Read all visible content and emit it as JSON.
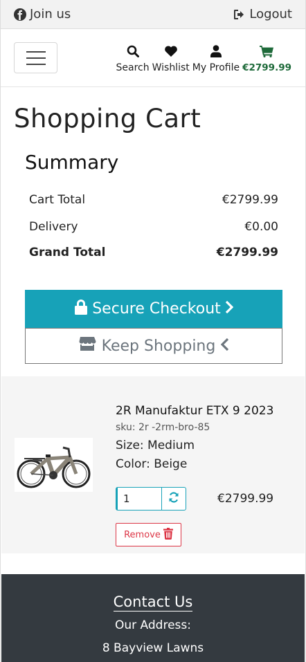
{
  "topbar": {
    "join_label": "Join us",
    "logout_label": "Logout"
  },
  "nav": {
    "search_label": "Search",
    "wishlist_label": "Wishlist",
    "profile_label": "My Profile",
    "cart_total": "€2799.99"
  },
  "page_title": "Shopping Cart",
  "summary": {
    "heading": "Summary",
    "rows": [
      {
        "label": "Cart Total",
        "value": "€2799.99"
      },
      {
        "label": "Delivery",
        "value": "€0.00"
      },
      {
        "label": "Grand Total",
        "value": "€2799.99"
      }
    ]
  },
  "buttons": {
    "checkout_label": "Secure Checkout",
    "keep_shopping_label": "Keep Shopping",
    "remove_label": "Remove"
  },
  "cart_item": {
    "name": "2R Manufaktur ETX 9 2023",
    "sku": "sku: 2r -2rm-bro-85",
    "size": "Size: Medium",
    "color": "Color: Beige",
    "quantity": "1",
    "price": "€2799.99"
  },
  "footer": {
    "contact_heading": "Contact Us",
    "address_label": "Our Address:",
    "address_line1": "8 Bayview Lawns"
  },
  "colors": {
    "accent": "#17a2b8",
    "cart_green": "#1e6a3a",
    "danger": "#dc3545",
    "footer_bg": "#343a40"
  }
}
